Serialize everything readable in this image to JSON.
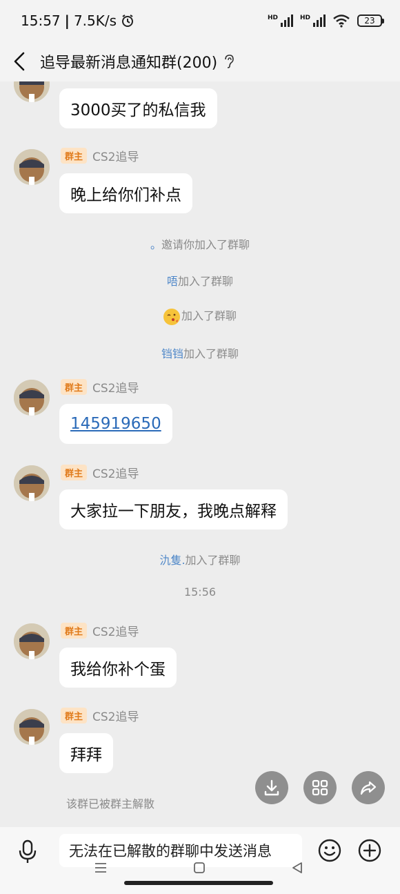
{
  "status_bar": {
    "time": "15:57",
    "speed": "7.5K/s",
    "network1": "HD",
    "network2": "HD",
    "battery": "23"
  },
  "header": {
    "title": "追导最新消息通知群(200)"
  },
  "messages": [
    {
      "text": "3000买了的私信我"
    },
    {
      "badge": "群主",
      "sender": "CS2追导",
      "text": "晚上给你们补点"
    },
    {
      "badge": "群主",
      "sender": "CS2追导",
      "text": "145919650"
    },
    {
      "badge": "群主",
      "sender": "CS2追导",
      "text": "大家拉一下朋友，我晚点解释"
    },
    {
      "badge": "群主",
      "sender": "CS2追导",
      "text": "我给你补个蛋"
    },
    {
      "badge": "群主",
      "sender": "CS2追导",
      "text": "拜拜"
    }
  ],
  "system": [
    {
      "nick": "。",
      "text": "邀请你加入了群聊"
    },
    {
      "nick": "唔",
      "text": "加入了群聊"
    },
    {
      "nick": "",
      "text": "加入了群聊"
    },
    {
      "nick": "铛铛",
      "text": "加入了群聊"
    },
    {
      "nick": "氿隻.",
      "text": "加入了群聊"
    }
  ],
  "timestamp": "15:56",
  "dissolved_notice": "该群已被群主解散",
  "input": {
    "placeholder": "无法在已解散的群聊中发送消息"
  },
  "icons": {
    "back": "back-arrow-icon",
    "ear": "ear-icon",
    "download": "download-icon",
    "grid": "grid-icon",
    "share": "share-icon",
    "mic": "microphone-icon",
    "emoji": "smile-icon",
    "plus": "plus-icon"
  },
  "colors": {
    "background": "#ededed",
    "bubble": "#ffffff",
    "badge_bg": "#fde3c5",
    "badge_text": "#e07a1a",
    "link": "#2a6ab8",
    "nick": "#4d86c8",
    "system_text": "#8a8a8a"
  }
}
